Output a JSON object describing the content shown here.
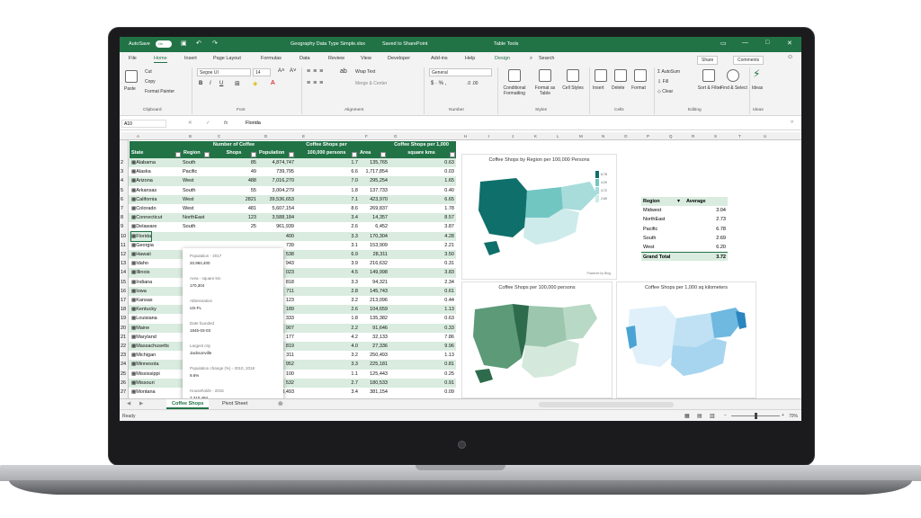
{
  "titlebar": {
    "autosave": "AutoSave",
    "toggle": "On",
    "filename": "Geography Data Type Simple.xlsx",
    "saved": "Saved to SharePoint",
    "table_tools": "Table Tools"
  },
  "tabs": [
    "File",
    "Home",
    "Insert",
    "Page Layout",
    "Formulas",
    "Data",
    "Review",
    "View",
    "Developer",
    "Add-ins",
    "Help",
    "Design"
  ],
  "search": "Search",
  "share": "Share",
  "comments": "Comments",
  "ribbon": {
    "cut": "Cut",
    "copy": "Copy",
    "format_painter": "Format Painter",
    "paste": "Paste",
    "font_name": "Segoe UI",
    "font_size": "14",
    "wrap_text": "Wrap Text",
    "merge_center": "Merge & Center",
    "number_format": "General",
    "conditional": "Conditional Formatting",
    "format_table": "Format as Table",
    "cell_styles": "Cell Styles",
    "insert": "Insert",
    "delete": "Delete",
    "format": "Format",
    "autosum": "AutoSum",
    "fill": "Fill",
    "clear": "Clear",
    "sort_filter": "Sort & Filter",
    "find_select": "Find & Select",
    "ideas": "Ideas",
    "groups": {
      "clipboard": "Clipboard",
      "font": "Font",
      "alignment": "Alignment",
      "number": "Number",
      "styles": "Styles",
      "cells": "Cells",
      "editing": "Editing",
      "ideas": "Ideas"
    }
  },
  "formula": {
    "name_box": "A10",
    "fx": "fx",
    "value": "Florida"
  },
  "columns": [
    "A",
    "B",
    "C",
    "D",
    "E",
    "F",
    "G",
    "H",
    "I",
    "J",
    "K",
    "L",
    "M",
    "N",
    "O",
    "P",
    "Q",
    "R",
    "S",
    "T",
    "U"
  ],
  "headers": {
    "state": "State",
    "region": "Region",
    "shops": "Number of Coffee Shops",
    "pop": "Population",
    "per100k": "Coffee Shops per 100,000 persons",
    "area": "Area",
    "per1000": "Coffee Shops per 1,000 square kms"
  },
  "rows": [
    {
      "n": "2",
      "state": "Alabama",
      "region": "South",
      "shops": "85",
      "pop": "4,874,747",
      "per100k": "1.7",
      "area": "135,765",
      "per1000": "0.63"
    },
    {
      "n": "3",
      "state": "Alaska",
      "region": "Pacific",
      "shops": "49",
      "pop": "739,795",
      "per100k": "6.6",
      "area": "1,717,854",
      "per1000": "0.03"
    },
    {
      "n": "4",
      "state": "Arizona",
      "region": "West",
      "shops": "488",
      "pop": "7,016,270",
      "per100k": "7.0",
      "area": "295,254",
      "per1000": "1.65"
    },
    {
      "n": "5",
      "state": "Arkansas",
      "region": "South",
      "shops": "55",
      "pop": "3,004,279",
      "per100k": "1.8",
      "area": "137,733",
      "per1000": "0.40"
    },
    {
      "n": "6",
      "state": "California",
      "region": "West",
      "shops": "2821",
      "pop": "39,536,653",
      "per100k": "7.1",
      "area": "423,970",
      "per1000": "6.65"
    },
    {
      "n": "7",
      "state": "Colorado",
      "region": "West",
      "shops": "481",
      "pop": "5,607,154",
      "per100k": "8.6",
      "area": "269,837",
      "per1000": "1.78"
    },
    {
      "n": "8",
      "state": "Connecticut",
      "region": "NorthEast",
      "shops": "123",
      "pop": "3,588,184",
      "per100k": "3.4",
      "area": "14,357",
      "per1000": "8.57"
    },
    {
      "n": "9",
      "state": "Delaware",
      "region": "South",
      "shops": "25",
      "pop": "961,939",
      "per100k": "2.6",
      "area": "6,452",
      "per1000": "3.87"
    },
    {
      "n": "10",
      "state": "Florida",
      "region": "",
      "shops": "",
      "pop": "400",
      "per100k": "3.3",
      "area": "170,304",
      "per1000": "4.28"
    },
    {
      "n": "11",
      "state": "Georgia",
      "region": "",
      "shops": "",
      "pop": "739",
      "per100k": "3.1",
      "area": "153,909",
      "per1000": "2.21"
    },
    {
      "n": "12",
      "state": "Hawaii",
      "region": "",
      "shops": "",
      "pop": "538",
      "per100k": "6.9",
      "area": "28,311",
      "per1000": "3.50"
    },
    {
      "n": "13",
      "state": "Idaho",
      "region": "",
      "shops": "",
      "pop": "943",
      "per100k": "3.9",
      "area": "216,632",
      "per1000": "0.31"
    },
    {
      "n": "14",
      "state": "Illinois",
      "region": "",
      "shops": "",
      "pop": "023",
      "per100k": "4.5",
      "area": "149,998",
      "per1000": "3.83"
    },
    {
      "n": "15",
      "state": "Indiana",
      "region": "",
      "shops": "",
      "pop": "818",
      "per100k": "3.3",
      "area": "94,321",
      "per1000": "2.34"
    },
    {
      "n": "16",
      "state": "Iowa",
      "region": "",
      "shops": "",
      "pop": "711",
      "per100k": "2.8",
      "area": "145,743",
      "per1000": "0.61"
    },
    {
      "n": "17",
      "state": "Kansas",
      "region": "",
      "shops": "",
      "pop": "123",
      "per100k": "3.2",
      "area": "213,096",
      "per1000": "0.44"
    },
    {
      "n": "18",
      "state": "Kentucky",
      "region": "",
      "shops": "",
      "pop": "189",
      "per100k": "2.6",
      "area": "104,659",
      "per1000": "1.13"
    },
    {
      "n": "19",
      "state": "Louisiana",
      "region": "",
      "shops": "",
      "pop": "333",
      "per100k": "1.8",
      "area": "135,382",
      "per1000": "0.63"
    },
    {
      "n": "20",
      "state": "Maine",
      "region": "",
      "shops": "",
      "pop": "907",
      "per100k": "2.2",
      "area": "91,646",
      "per1000": "0.33"
    },
    {
      "n": "21",
      "state": "Maryland",
      "region": "",
      "shops": "",
      "pop": "177",
      "per100k": "4.2",
      "area": "32,133",
      "per1000": "7.86"
    },
    {
      "n": "22",
      "state": "Massachusetts",
      "region": "",
      "shops": "",
      "pop": "819",
      "per100k": "4.0",
      "area": "27,336",
      "per1000": "9.96"
    },
    {
      "n": "23",
      "state": "Michigan",
      "region": "",
      "shops": "",
      "pop": "311",
      "per100k": "3.2",
      "area": "250,493",
      "per1000": "1.13"
    },
    {
      "n": "24",
      "state": "Minnesota",
      "region": "",
      "shops": "",
      "pop": "952",
      "per100k": "3.3",
      "area": "225,181",
      "per1000": "0.81"
    },
    {
      "n": "25",
      "state": "Mississippi",
      "region": "",
      "shops": "",
      "pop": "100",
      "per100k": "1.1",
      "area": "125,443",
      "per1000": "0.25"
    },
    {
      "n": "26",
      "state": "Missouri",
      "region": "",
      "shops": "",
      "pop": "532",
      "per100k": "2.7",
      "area": "180,533",
      "per1000": "0.91"
    },
    {
      "n": "27",
      "state": "Montana",
      "region": "West",
      "shops": "36",
      "pop": "1,050,493",
      "per100k": "3.4",
      "area": "381,154",
      "per1000": "0.09"
    }
  ],
  "card": {
    "items": [
      {
        "label": "Population - 2017",
        "value": "20,984,400"
      },
      {
        "label": "Area - square km",
        "value": "170,304"
      },
      {
        "label": "Abbreviation",
        "value": "US-FL"
      },
      {
        "label": "Date founded",
        "value": "1845-03-03"
      },
      {
        "label": "Largest city",
        "value": "Jacksonville"
      },
      {
        "label": "Population change (%) - 2010, 2018",
        "value": "9.6%"
      },
      {
        "label": "Households - 2015",
        "value": "7,310,494"
      }
    ],
    "footer": "Powered by Bing"
  },
  "pivot": {
    "header_region": "Region",
    "header_avg": "Average",
    "rows": [
      {
        "r": "Midwest",
        "v": "3.04"
      },
      {
        "r": "NorthEast",
        "v": "2.73"
      },
      {
        "r": "Pacific",
        "v": "6.78"
      },
      {
        "r": "South",
        "v": "2.69"
      },
      {
        "r": "West",
        "v": "6.20"
      }
    ],
    "total_label": "Grand Total",
    "total": "3.72"
  },
  "charts": {
    "region": {
      "title": "Coffee Shops by Region per 100,000 Persons",
      "legend": [
        "6.78",
        "4.20",
        "3.72",
        "2.69"
      ],
      "credit": "Powered by Bing"
    },
    "persons": {
      "title": "Coffee Shops per 100,000 persons"
    },
    "sqkm": {
      "title": "Coffee Shops per 1,000 sq kilometers"
    }
  },
  "sheets": [
    "Coffee Shops",
    "Pivot Sheet"
  ],
  "status": {
    "ready": "Ready",
    "zoom": "70%"
  },
  "colors": {
    "excel_green": "#217346",
    "teal": "#136f63",
    "band": "#d9ecdf"
  }
}
